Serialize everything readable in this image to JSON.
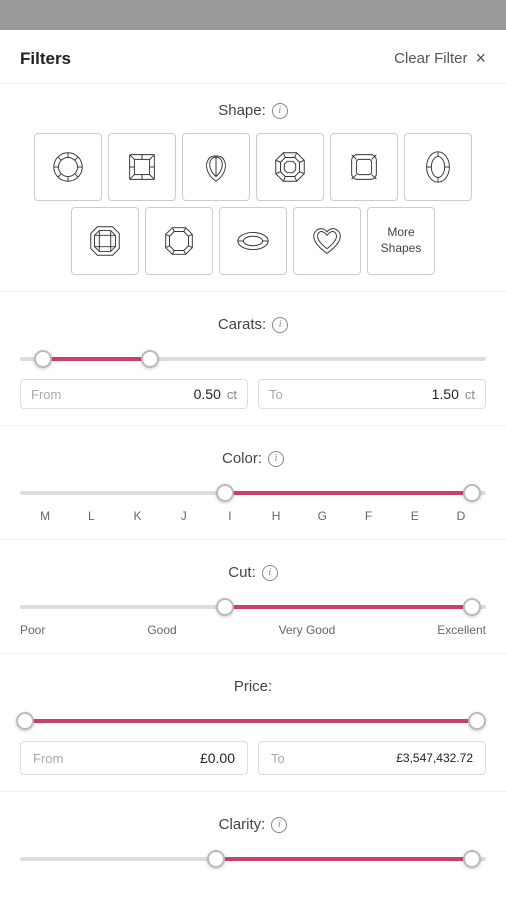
{
  "topbar": {},
  "header": {
    "title": "Filters",
    "clear_label": "Clear Filter",
    "close_label": "×"
  },
  "shape_section": {
    "label": "Shape:",
    "shapes": [
      {
        "name": "round",
        "label": ""
      },
      {
        "name": "princess",
        "label": ""
      },
      {
        "name": "pear",
        "label": ""
      },
      {
        "name": "asscher",
        "label": ""
      },
      {
        "name": "cushion",
        "label": ""
      },
      {
        "name": "oval",
        "label": ""
      },
      {
        "name": "emerald",
        "label": ""
      },
      {
        "name": "radiant",
        "label": ""
      },
      {
        "name": "marquise",
        "label": ""
      },
      {
        "name": "heart",
        "label": ""
      }
    ],
    "more_shapes_label": "More Shapes"
  },
  "carats_section": {
    "label": "Carats:",
    "from_label": "From",
    "to_label": "To",
    "from_value": "0.50",
    "to_value": "1.50",
    "unit": "ct",
    "thumb_left_pct": 5,
    "thumb_right_pct": 28
  },
  "color_section": {
    "label": "Color:",
    "grades": [
      "M",
      "L",
      "K",
      "J",
      "I",
      "H",
      "G",
      "F",
      "E",
      "D"
    ],
    "thumb_left_pct": 44,
    "thumb_right_pct": 97,
    "fill_start_pct": 44,
    "fill_end_pct": 97
  },
  "cut_section": {
    "label": "Cut:",
    "labels": [
      "Poor",
      "Good",
      "Very Good",
      "Excellent"
    ],
    "thumb_left_pct": 44,
    "thumb_right_pct": 97,
    "fill_start_pct": 44,
    "fill_end_pct": 97
  },
  "price_section": {
    "label": "Price:",
    "from_label": "From",
    "to_label": "To",
    "from_value": "£0.00",
    "to_value": "£3,547,432.72",
    "thumb_left_pct": 1,
    "thumb_right_pct": 98
  },
  "clarity_section": {
    "label": "Clarity:",
    "thumb_left_pct": 42,
    "thumb_right_pct": 97
  }
}
